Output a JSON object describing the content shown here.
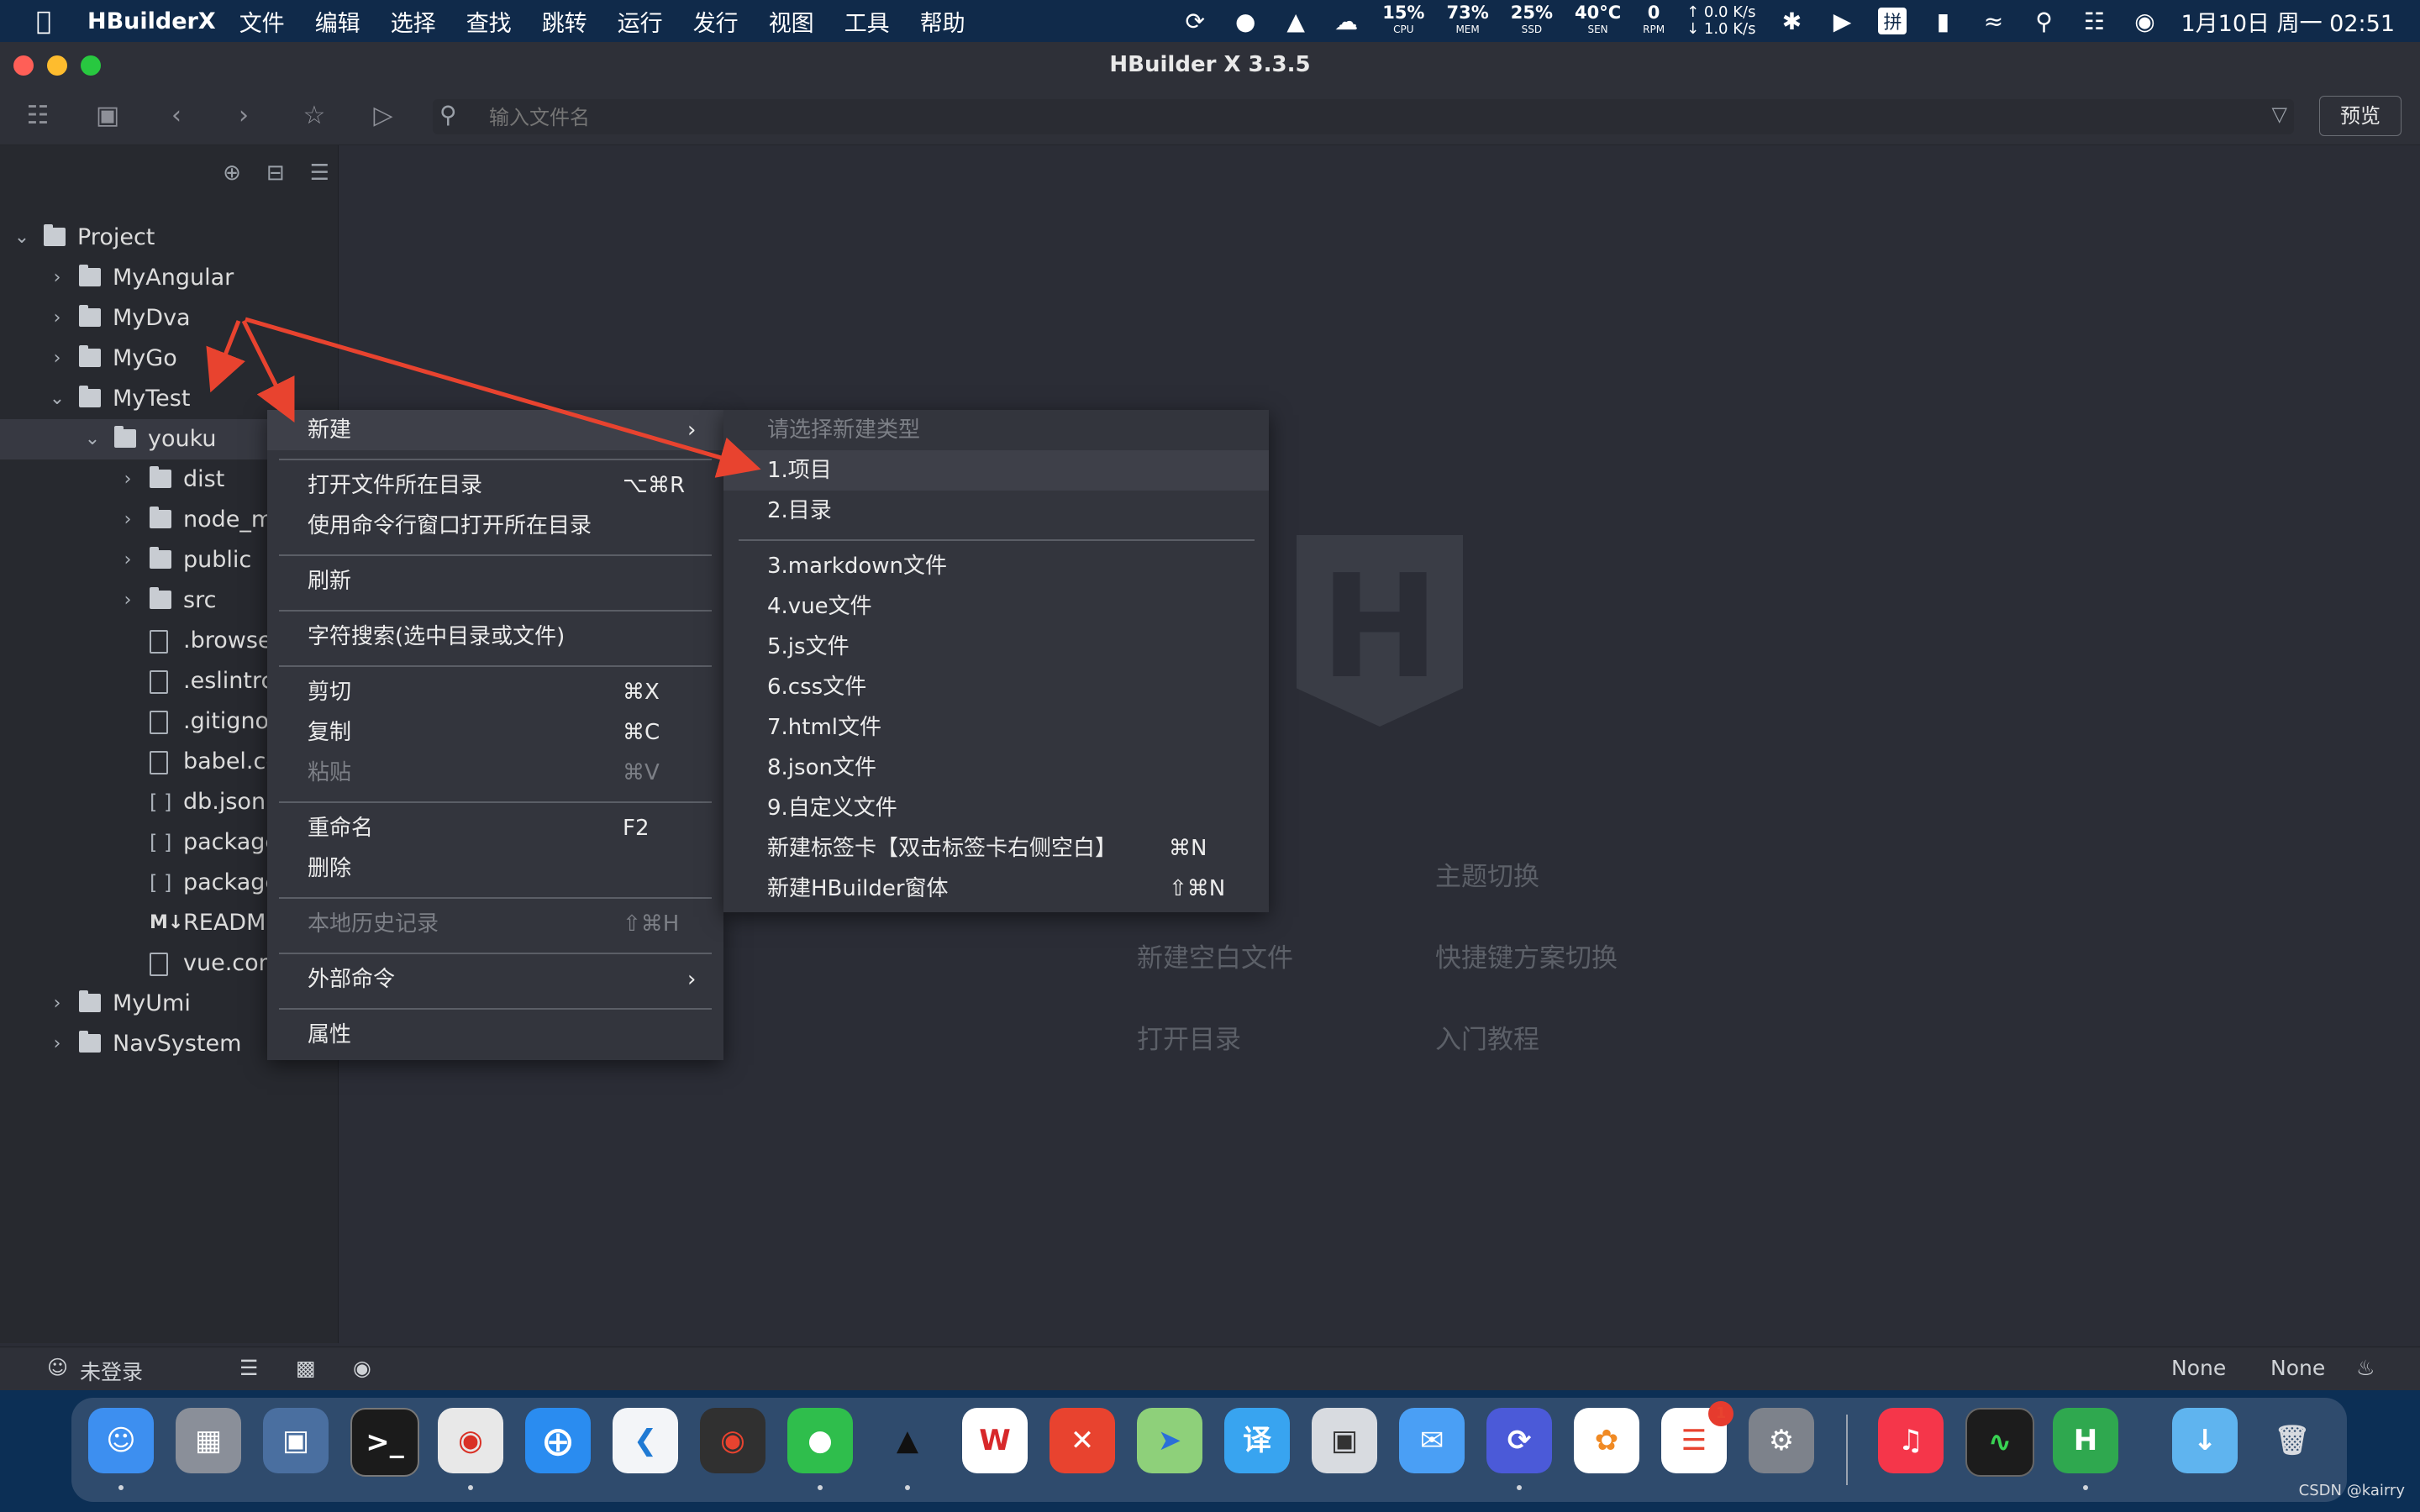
{
  "menubar": {
    "app_name": "HBuilderX",
    "menus": [
      "文件",
      "编辑",
      "选择",
      "查找",
      "跳转",
      "运行",
      "发行",
      "视图",
      "工具",
      "帮助"
    ],
    "cpu": {
      "value": "15%",
      "label": "CPU"
    },
    "mem": {
      "value": "73%",
      "label": "MEM"
    },
    "ssd": {
      "value": "25%",
      "label": "SSD"
    },
    "sen": {
      "value": "40°C",
      "label": "SEN"
    },
    "rpm": {
      "value": "0",
      "label": "RPM"
    },
    "net_up": "↑ 0.0 K/s",
    "net_down": "↓ 1.0 K/s",
    "input_method": "拼",
    "datetime": "1月10日 周一  02:51"
  },
  "window": {
    "title": "HBuilder X 3.3.5",
    "search_placeholder": "输入文件名",
    "preview_label": "预览"
  },
  "tree": [
    {
      "label": "Project",
      "kind": "root",
      "depth": 0,
      "expanded": true
    },
    {
      "label": "MyAngular",
      "kind": "folder",
      "depth": 1,
      "expanded": false
    },
    {
      "label": "MyDva",
      "kind": "folder",
      "depth": 1,
      "expanded": false
    },
    {
      "label": "MyGo",
      "kind": "folder",
      "depth": 1,
      "expanded": false
    },
    {
      "label": "MyTest",
      "kind": "folder",
      "depth": 1,
      "expanded": true
    },
    {
      "label": "youku",
      "kind": "folder",
      "depth": 2,
      "expanded": true
    },
    {
      "label": "dist",
      "kind": "folder",
      "depth": 3,
      "expanded": false
    },
    {
      "label": "node_m",
      "kind": "folder",
      "depth": 3,
      "expanded": false
    },
    {
      "label": "public",
      "kind": "folder",
      "depth": 3,
      "expanded": false
    },
    {
      "label": "src",
      "kind": "folder",
      "depth": 3,
      "expanded": false
    },
    {
      "label": ".browse",
      "kind": "file",
      "depth": 3
    },
    {
      "label": ".eslintrc",
      "kind": "file",
      "depth": 3
    },
    {
      "label": ".gitigno",
      "kind": "file",
      "depth": 3
    },
    {
      "label": "babel.co",
      "kind": "file",
      "depth": 3
    },
    {
      "label": "db.json",
      "kind": "json",
      "depth": 3
    },
    {
      "label": "package",
      "kind": "json",
      "depth": 3
    },
    {
      "label": "package",
      "kind": "json",
      "depth": 3
    },
    {
      "label": "READMI",
      "kind": "md",
      "depth": 3
    },
    {
      "label": "vue.con",
      "kind": "file",
      "depth": 3
    },
    {
      "label": "MyUmi",
      "kind": "folder",
      "depth": 1,
      "expanded": false
    },
    {
      "label": "NavSystem",
      "kind": "folder",
      "depth": 1,
      "expanded": false
    }
  ],
  "welcome": {
    "theme_switch": "主题切换",
    "new_blank_file": "新建空白文件",
    "keymap_switch": "快捷键方案切换",
    "open_dir": "打开目录",
    "tutorial": "入门教程"
  },
  "context_menu": {
    "new": "新建",
    "open_dir": "打开文件所在目录",
    "open_dir_sc": "⌥⌘R",
    "open_in_terminal": "使用命令行窗口打开所在目录",
    "refresh": "刷新",
    "search_text": "字符搜索(选中目录或文件)",
    "cut": "剪切",
    "cut_sc": "⌘X",
    "copy": "复制",
    "copy_sc": "⌘C",
    "paste": "粘贴",
    "paste_sc": "⌘V",
    "rename": "重命名",
    "rename_sc": "F2",
    "delete": "删除",
    "history": "本地历史记录",
    "history_sc": "⇧⌘H",
    "external": "外部命令",
    "properties": "属性"
  },
  "submenu": {
    "header": "请选择新建类型",
    "project": "1.项目",
    "directory": "2.目录",
    "markdown": "3.markdown文件",
    "vue": "4.vue文件",
    "js": "5.js文件",
    "css": "6.css文件",
    "html": "7.html文件",
    "json": "8.json文件",
    "custom": "9.自定义文件",
    "new_tab": "新建标签卡【双击标签卡右侧空白】",
    "new_tab_sc": "⌘N",
    "new_window": "新建HBuilder窗体",
    "new_window_sc": "⇧⌘N"
  },
  "statusbar": {
    "login": "未登录",
    "none1": "None",
    "none2": "None"
  },
  "dock": {
    "badge": "1",
    "watermark": "CSDN @kairry"
  },
  "colors": {
    "annotation_arrow": "#e8432f",
    "hbuilder_green": "#2fa84f"
  }
}
